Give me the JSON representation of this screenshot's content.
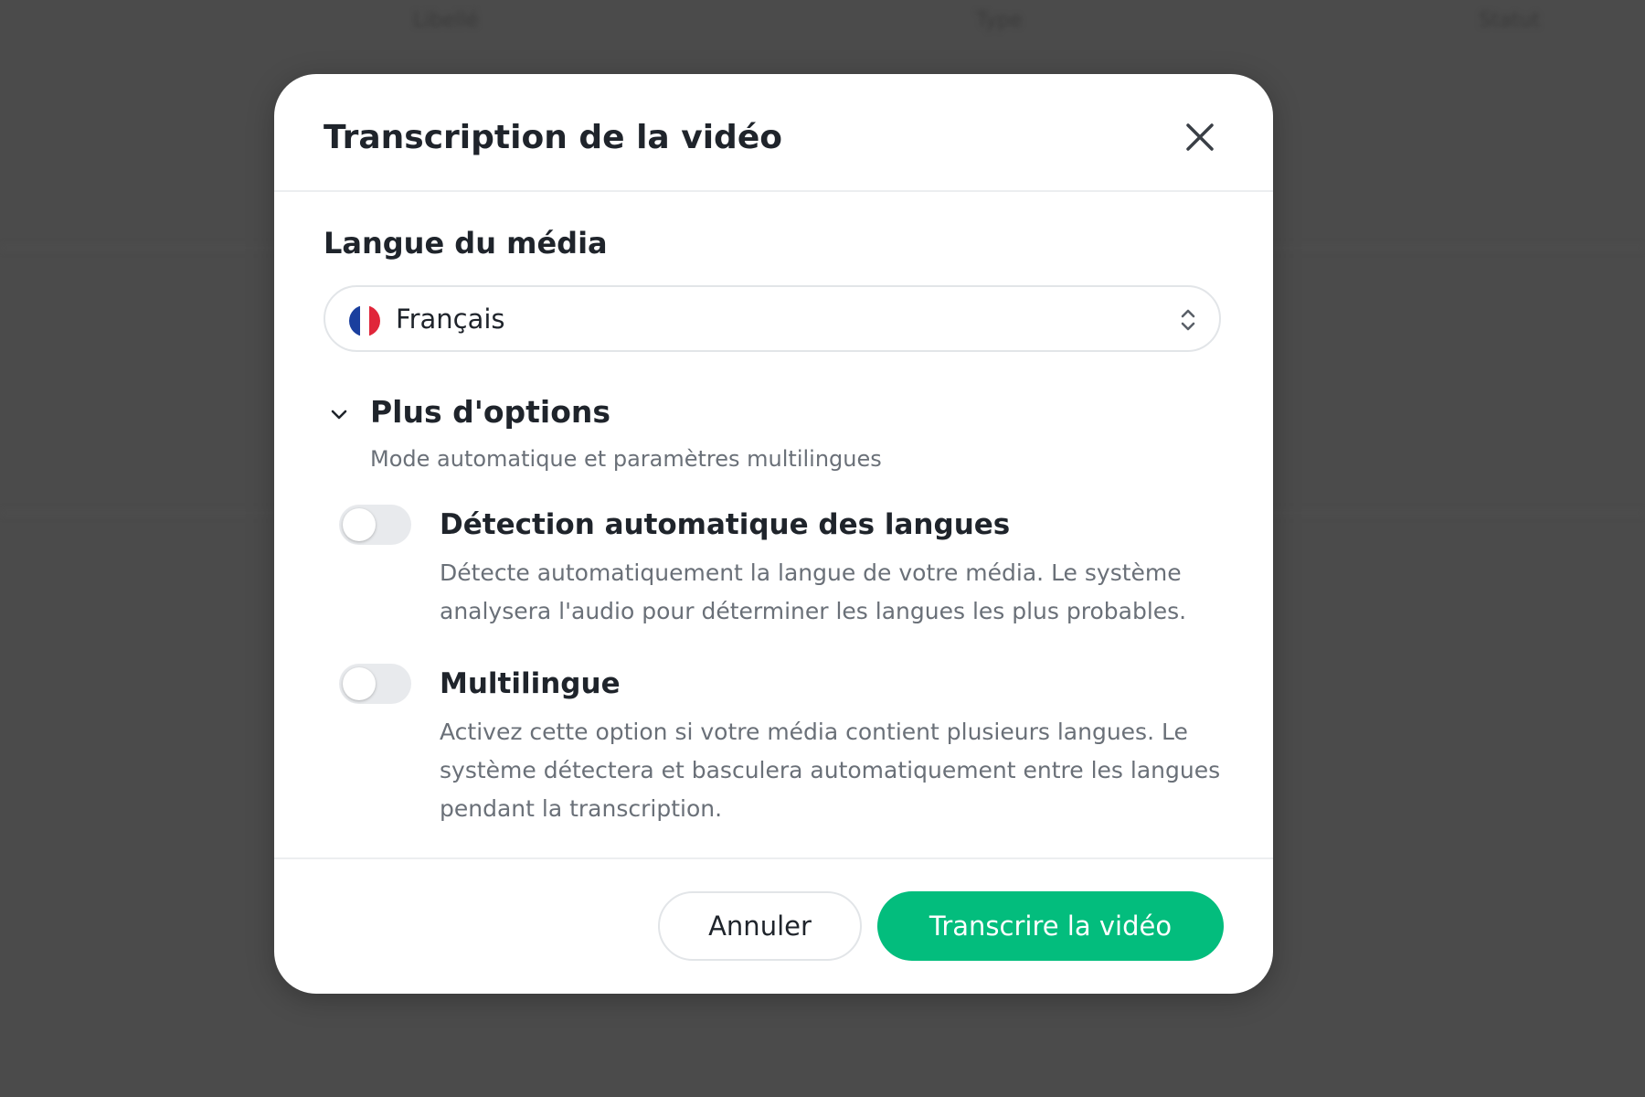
{
  "background": {
    "columns": [
      "Libellé",
      "Type",
      "Statut"
    ]
  },
  "modal": {
    "title": "Transcription de la vidéo",
    "close_icon": "close-icon",
    "language_label": "Langue du média",
    "language_select": {
      "selected": "Français",
      "flag_icon": "france-flag-icon",
      "chevron_icon": "chevron-up-down-icon"
    },
    "more_options": {
      "title": "Plus d'options",
      "subtitle": "Mode automatique et paramètres multilingues",
      "expanded": true,
      "options": [
        {
          "title": "Détection automatique des langues",
          "description": "Détecte automatiquement la langue de votre média. Le système analysera l'audio pour déterminer les langues les plus probables.",
          "enabled": false
        },
        {
          "title": "Multilingue",
          "description": "Activez cette option si votre média contient plusieurs langues. Le système détectera et basculera automatiquement entre les langues pendant la transcription.",
          "enabled": false
        }
      ]
    },
    "footer": {
      "cancel_label": "Annuler",
      "confirm_label": "Transcrire la vidéo"
    }
  },
  "colors": {
    "overlay": "#4b4b4b",
    "primary": "#03bd7d",
    "text": "#1f242b",
    "muted_text": "#6a7078"
  }
}
